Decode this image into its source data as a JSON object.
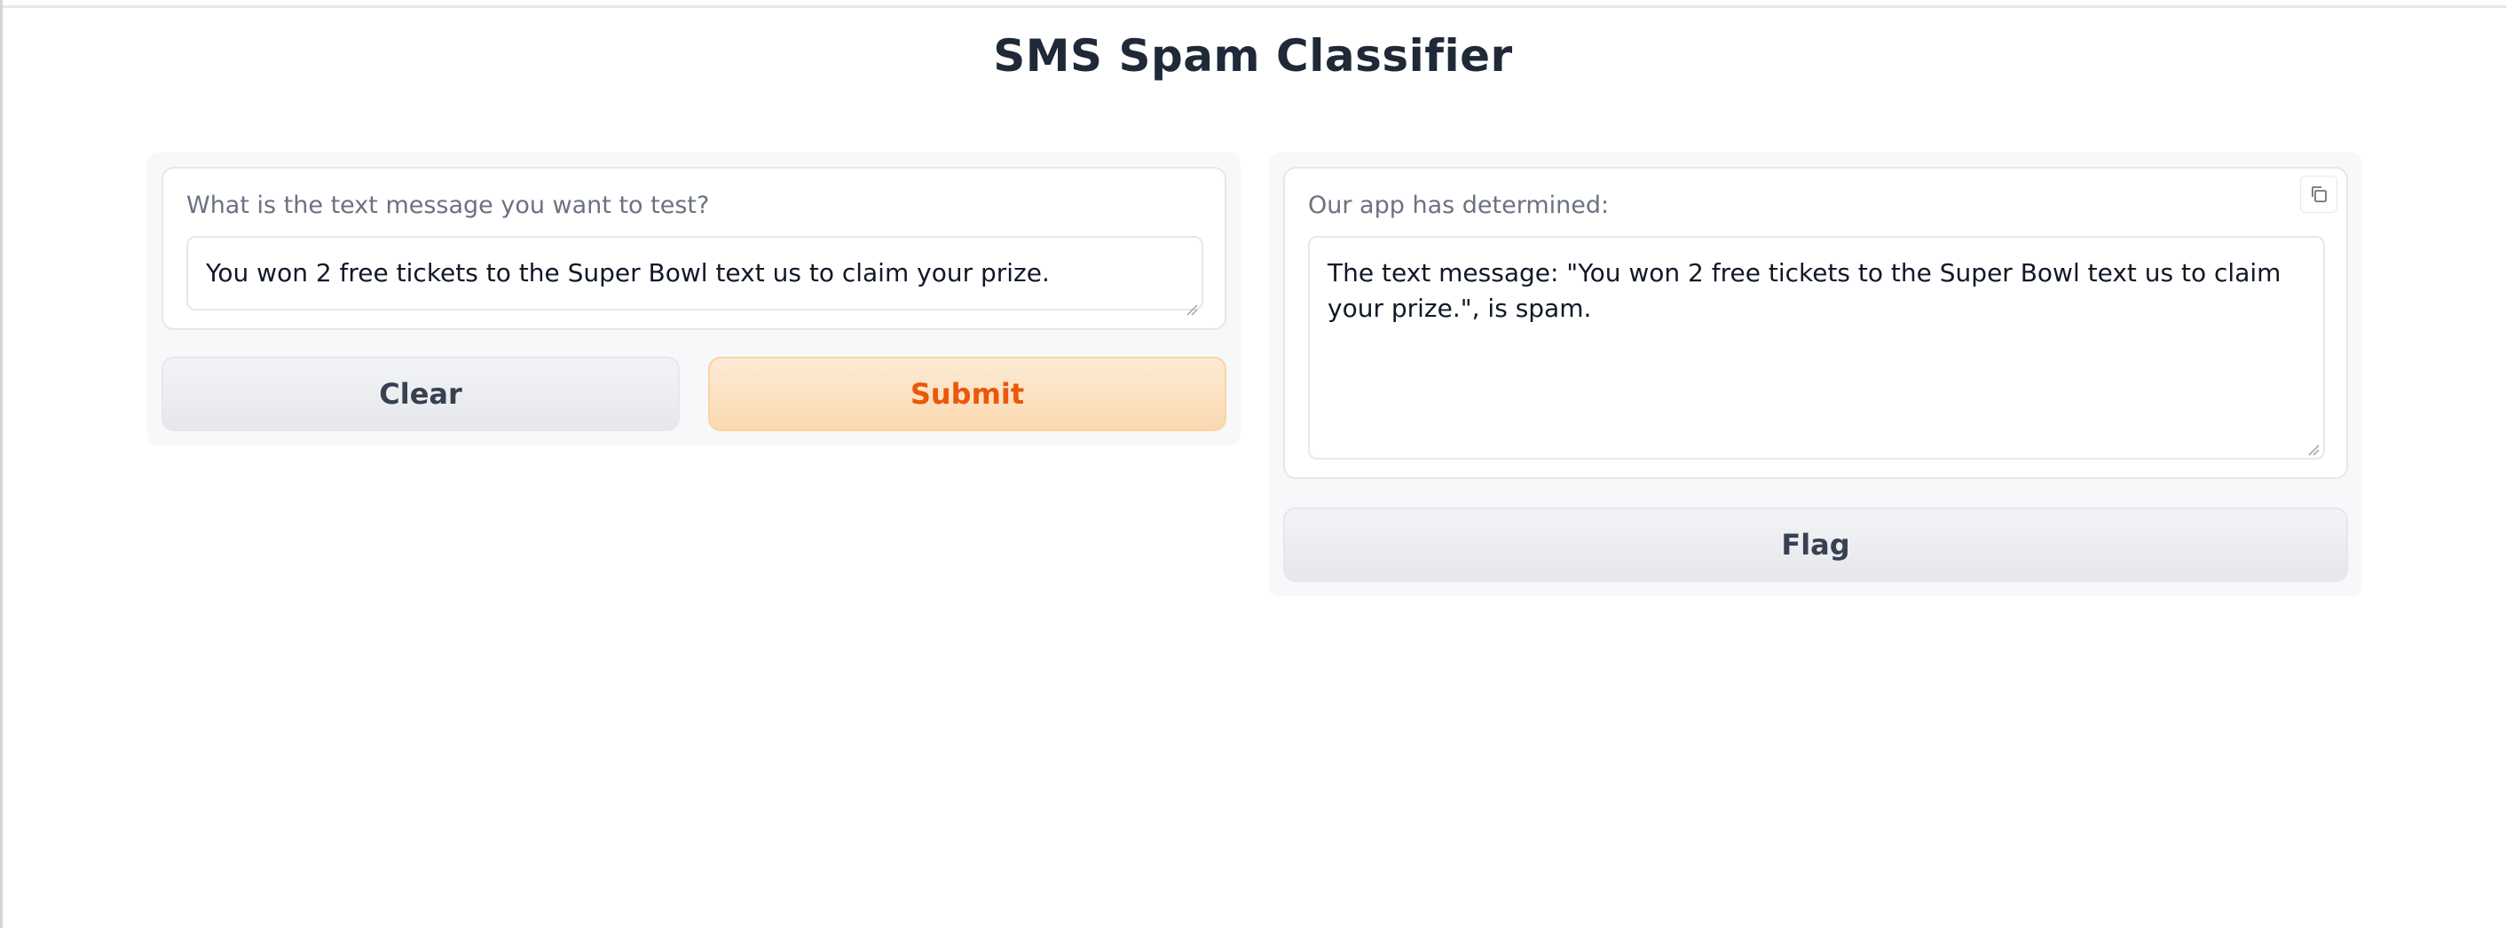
{
  "app": {
    "title": "SMS Spam Classifier"
  },
  "input_panel": {
    "label": "What is the text message you want to test?",
    "value": "You won 2 free tickets to the Super Bowl text us to claim your prize.",
    "clear_label": "Clear",
    "submit_label": "Submit"
  },
  "output_panel": {
    "label": "Our app has determined:",
    "value": "The text message: \"You won 2 free tickets to the Super Bowl text us to claim your prize.\", is spam.",
    "copy_icon": "copy-icon",
    "flag_label": "Flag"
  },
  "colors": {
    "primary_text": "#ea580c",
    "primary_bg": "#fbd9b0",
    "secondary_bg": "#e5e7eb"
  }
}
